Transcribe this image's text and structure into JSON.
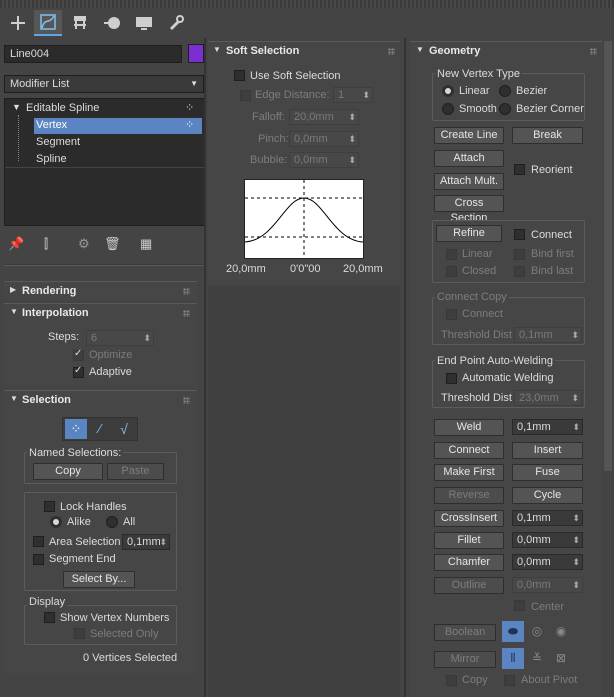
{
  "tabs": [
    {
      "icon": "plus-icon"
    },
    {
      "icon": "modify-icon"
    },
    {
      "icon": "hierarchy-icon"
    },
    {
      "icon": "motion-icon"
    },
    {
      "icon": "display-icon"
    },
    {
      "icon": "utilities-icon"
    }
  ],
  "object": {
    "name": "Line004",
    "color": "#7b2fd0"
  },
  "modifier_list": "Modifier List",
  "stack": {
    "root": "Editable Spline",
    "items": [
      "Vertex",
      "Segment",
      "Spline"
    ]
  },
  "rendering": {
    "title": "Rendering"
  },
  "interpolation": {
    "title": "Interpolation",
    "steps_label": "Steps:",
    "steps_value": "6",
    "optimize": "Optimize",
    "adaptive": "Adaptive"
  },
  "selection": {
    "title": "Selection",
    "named_label": "Named Selections:",
    "copy": "Copy",
    "paste": "Paste",
    "lock_handles": "Lock Handles",
    "alike": "Alike",
    "all": "All",
    "area_selection": "Area Selection",
    "area_value": "0,1mm",
    "segment_end": "Segment End",
    "select_by": "Select By...",
    "display_label": "Display",
    "show_vertex_numbers": "Show Vertex Numbers",
    "selected_only": "Selected Only",
    "status": "0 Vertices Selected"
  },
  "soft": {
    "title": "Soft Selection",
    "use": "Use Soft Selection",
    "edge_distance": "Edge Distance:",
    "edge_value": "1",
    "falloff": "Falloff:",
    "falloff_value": "20,0mm",
    "pinch": "Pinch:",
    "pinch_value": "0,0mm",
    "bubble": "Bubble:",
    "bubble_value": "0,0mm",
    "left": "20,0mm",
    "center": "0'0\"00",
    "right": "20,0mm"
  },
  "geometry": {
    "title": "Geometry",
    "new_vertex_type": "New Vertex Type",
    "linear": "Linear",
    "bezier": "Bezier",
    "smooth": "Smooth",
    "bezier_corner": "Bezier Corner",
    "create_line": "Create Line",
    "break": "Break",
    "attach": "Attach",
    "reorient": "Reorient",
    "attach_mult": "Attach Mult.",
    "cross_section": "Cross Section",
    "refine": "Refine",
    "connect": "Connect",
    "linear_dis": "Linear",
    "bind_first": "Bind first",
    "closed": "Closed",
    "bind_last": "Bind last",
    "connect_copy": "Connect Copy",
    "connect_cb": "Connect",
    "threshold_dist": "Threshold Dist",
    "threshold_value": "0,1mm",
    "endpoint": "End Point Auto-Welding",
    "auto_welding": "Automatic Welding",
    "threshold_dist2": "Threshold Dist",
    "threshold_value2": "23,0mm",
    "weld": "Weld",
    "weld_value": "0,1mm",
    "connect_btn": "Connect",
    "insert": "Insert",
    "make_first": "Make First",
    "fuse": "Fuse",
    "reverse": "Reverse",
    "cycle": "Cycle",
    "crossinsert": "CrossInsert",
    "crossinsert_value": "0,1mm",
    "fillet": "Fillet",
    "fillet_value": "0,0mm",
    "chamfer": "Chamfer",
    "chamfer_value": "0,0mm",
    "outline": "Outline",
    "outline_value": "0,0mm",
    "center": "Center",
    "boolean": "Boolean",
    "mirror": "Mirror",
    "copy": "Copy",
    "about_pivot": "About Pivot"
  },
  "colors": {
    "accent": "#5ea6e6",
    "selection": "#5b84c2",
    "curve_bg": "#ffffff"
  }
}
